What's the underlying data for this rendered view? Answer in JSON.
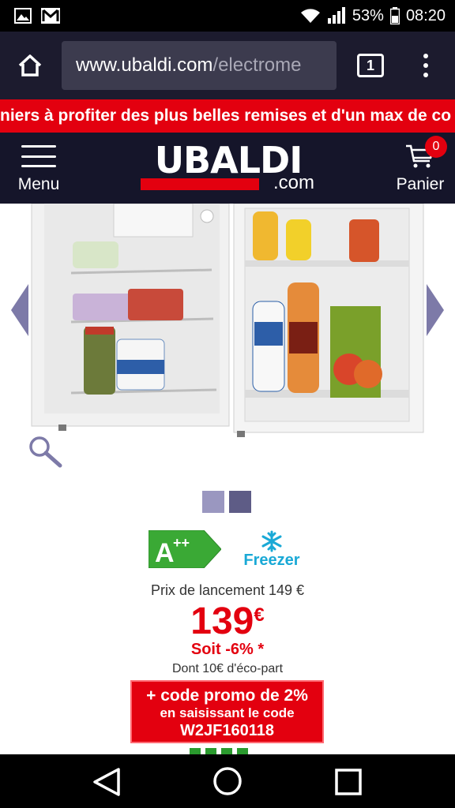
{
  "status_bar": {
    "battery": "53%",
    "time": "08:20",
    "icons": [
      "image-notification-icon",
      "gmail-notification-icon",
      "wifi-icon",
      "signal-icon",
      "battery-icon"
    ]
  },
  "browser": {
    "url_host": "www.ubaldi.com",
    "url_path": "/electrome",
    "tab_count": "1"
  },
  "promo_banner": {
    "text": "niers à profiter des plus belles remises et d'un max de co"
  },
  "header": {
    "menu_label": "Menu",
    "logo_text": "UBALDI",
    "logo_suffix": ".com",
    "cart_label": "Panier",
    "cart_count": "0"
  },
  "product": {
    "image_alt": "Réfrigérateur table top blanc ouvert",
    "gallery_index": 1,
    "gallery_total": 2,
    "energy_class": "A++",
    "freezer_label": "Freezer",
    "launch_price": "Prix de lancement 149 €",
    "price": "139",
    "currency": "€",
    "discount": "Soit -6% *",
    "eco_part": "Dont 10€ d'éco-part",
    "promo_line1": "+ code promo de 2%",
    "promo_line2": "en saisissant le code",
    "promo_code": "W2JF160118"
  },
  "colors": {
    "brand_red": "#e3000f",
    "header_bg": "#15152a",
    "browser_bg": "#1c1b2e",
    "dot_active": "#9a97c0",
    "dot_inactive": "#5e5c86",
    "energy_green": "#3aa935",
    "freezer_blue": "#1aa9d6"
  }
}
